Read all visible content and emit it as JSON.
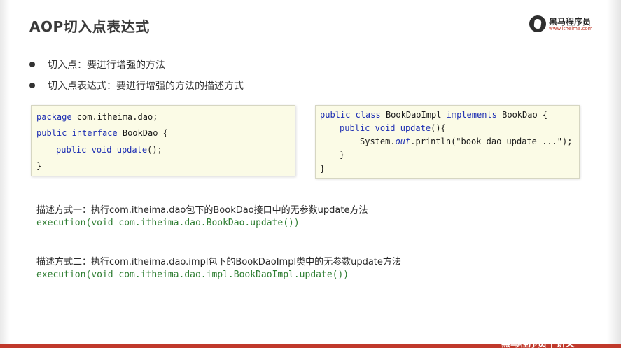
{
  "slide": {
    "title": "AOP切入点表达式",
    "logo": {
      "main": "黑马程序员",
      "sub": "www.itheima.com"
    },
    "bullets": [
      "切入点：要进行增强的方法",
      "切入点表达式：要进行增强的方法的描述方式"
    ],
    "code_left": {
      "line1": {
        "kw": "package",
        "rest": " com.itheima.dao;"
      },
      "line2": {
        "kw1": "public",
        "kw2": "interface",
        "rest": " BookDao {"
      },
      "line3": {
        "kw1": "public",
        "kw2": "void",
        "mth": "update",
        "rest": "();"
      },
      "line4": "}"
    },
    "code_right": {
      "line1": {
        "kw1": "public",
        "kw2": "class",
        "name": " BookDaoImpl ",
        "kw3": "implements",
        "rest": " BookDao {"
      },
      "line2": {
        "kw1": "public",
        "kw2": "void",
        "mth": "update",
        "rest": "(){"
      },
      "line3": {
        "pre": "System.",
        "it": "out",
        "mid": ".println(",
        "str": "\"book dao update ...\"",
        "end": ");"
      },
      "line4": "}",
      "line5": "}"
    },
    "desc1": "描述方式一：执行com.itheima.dao包下的BookDao接口中的无参数update方法",
    "expr1": "execution(void com.itheima.dao.BookDao.update())",
    "desc2": "描述方式二：执行com.itheima.dao.impl包下的BookDaoImpl类中的无参数update方法",
    "expr2": "execution(void com.itheima.dao.impl.BookDaoImpl.update())",
    "bottom_text": "黑马程序员 | 讲义",
    "colors": {
      "keyword": "#1e2fb3",
      "expression": "#2e7d32",
      "code_bg": "#fbfbe6",
      "bottom_bar": "#c0392b"
    }
  }
}
